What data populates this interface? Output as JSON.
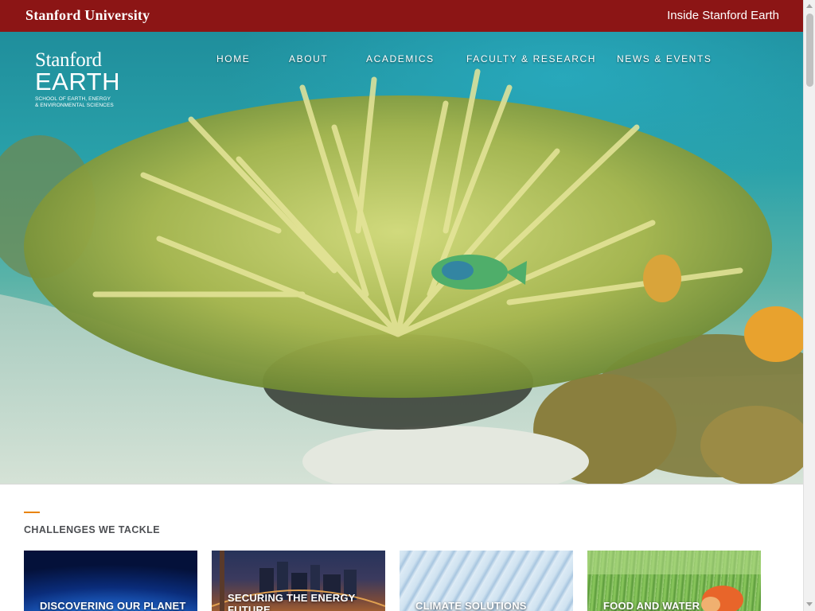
{
  "topbar": {
    "university": "Stanford University",
    "inside_link": "Inside Stanford Earth"
  },
  "logo": {
    "line1": "Stanford",
    "line2": "EARTH",
    "line3": "School of Earth, Energy",
    "line4": "& Environmental Sciences"
  },
  "nav": {
    "items": [
      {
        "label": "HOME"
      },
      {
        "label": "ABOUT"
      },
      {
        "label": "ACADEMICS"
      },
      {
        "label": "FACULTY & RESEARCH"
      },
      {
        "label": "NEWS & EVENTS"
      }
    ]
  },
  "hero": {
    "image": "underwater-coral-reef-video"
  },
  "challenges": {
    "title": "CHALLENGES WE TACKLE",
    "cards": [
      {
        "label": "DISCOVERING OUR PLANET",
        "image": "earth-from-space"
      },
      {
        "label": "SECURING THE ENERGY FUTURE",
        "image": "city-bridge-night"
      },
      {
        "label": "CLIMATE SOLUTIONS",
        "image": "ice-glacier"
      },
      {
        "label": "FOOD AND WATER SECURITY",
        "image": "rice-paddy-farmer"
      }
    ]
  },
  "colors": {
    "brand_red": "#8c1515",
    "accent_orange": "#e98300"
  }
}
